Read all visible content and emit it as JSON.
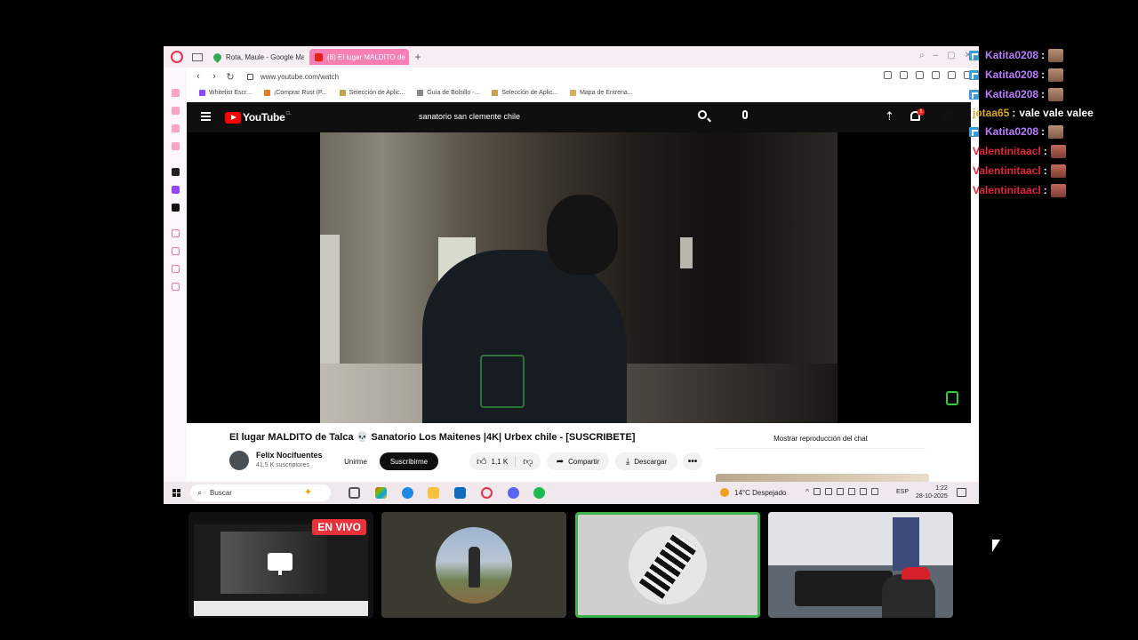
{
  "browser": {
    "tabs": [
      {
        "label": "Rota, Maule - Google Ma",
        "favicon": "maps-pin-icon",
        "active": false
      },
      {
        "label": "(8) El lugar MALDITO de",
        "favicon": "youtube-icon",
        "active": true
      }
    ],
    "url": "www.youtube.com/watch",
    "bookmarks": [
      {
        "label": "Whitelist Escr...",
        "icon": "twitch-icon"
      },
      {
        "label": "¡Comprar Rust (P...",
        "icon": "g-icon"
      },
      {
        "label": "Selección de Aplic...",
        "icon": "apps-icon"
      },
      {
        "label": "Guía de Bolsillo -...",
        "icon": "doc-icon"
      },
      {
        "label": "Selección de Aplic...",
        "icon": "apps-icon"
      },
      {
        "label": "Mapa de Entrena...",
        "icon": "map-icon"
      }
    ],
    "accent": "#f77fb3"
  },
  "youtube": {
    "logo_text": "YouTube",
    "logo_suffix": "CL",
    "search_query": "sanatorio san clemente chile",
    "notifications_count": "5",
    "video": {
      "title": "El lugar MALDITO de Talca 💀 Sanatorio Los Maitenes |4K| Urbex chile - [SUSCRIBETE]",
      "channel": "Felix Nocifuentes",
      "subscribers": "41,5 K suscriptores",
      "join_label": "Unirme",
      "subscribe_label": "Suscribirme",
      "likes": "1,1 K",
      "share_label": "Compartir",
      "download_label": "Descargar",
      "more_label": "•••"
    },
    "chat_replay_label": "Mostrar reproducción del chat"
  },
  "taskbar": {
    "search_label": "Buscar",
    "weather": "14°C Despejado",
    "language": "ESP",
    "time": "1:22",
    "date": "28-10-2025"
  },
  "chat": [
    {
      "user": "Katita0208",
      "color": "#b97bff",
      "message": "",
      "emote": "face-emote"
    },
    {
      "user": "Katita0208",
      "color": "#b97bff",
      "message": "",
      "emote": "face-emote"
    },
    {
      "user": "Katita0208",
      "color": "#b97bff",
      "message": "",
      "emote": "face-emote"
    },
    {
      "user": "jotaa65",
      "color": "#daa520",
      "message": "vale vale valee",
      "emote": ""
    },
    {
      "user": "Katita0208",
      "color": "#b97bff",
      "message": "",
      "emote": "face-emote"
    },
    {
      "user": "Valentinitaacl",
      "color": "#e0243a",
      "message": "",
      "emote": "red-face-emote"
    },
    {
      "user": "Valentinitaacl",
      "color": "#e0243a",
      "message": "",
      "emote": "red-face-emote"
    },
    {
      "user": "Valentinitaacl",
      "color": "#e0243a",
      "message": "",
      "emote": "red-face-emote"
    }
  ],
  "scenes": {
    "live_label": "EN VIVO"
  }
}
